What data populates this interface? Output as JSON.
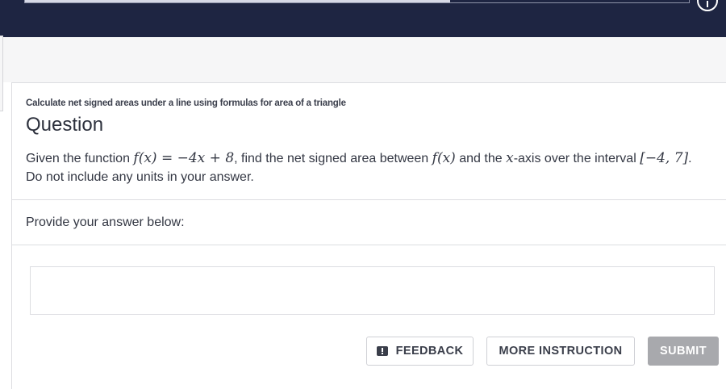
{
  "progress": {
    "fraction": 0.64
  },
  "colors": {
    "topbar": "#1e2542",
    "submit_disabled": "#a8a9ad",
    "page_band": "#f6f6f7"
  },
  "question": {
    "subtitle": "Calculate net signed areas under a line using formulas for area of a triangle",
    "title": "Question",
    "text_before_f": "Given the function ",
    "f_def": "f(x) = −4x + 8",
    "text_middle": ", find the net signed area between ",
    "f_ref": "f(x)",
    "text_and": " and the ",
    "x_var": "x",
    "text_axis": "-axis over the interval ",
    "interval": "[−4, 7]",
    "text_after": ". Do not include any units in your answer."
  },
  "answer": {
    "label": "Provide your answer below:",
    "value": ""
  },
  "buttons": {
    "feedback": "FEEDBACK",
    "more_instruction": "MORE INSTRUCTION",
    "submit": "SUBMIT"
  },
  "icons": {
    "info": "info-icon",
    "feedback": "feedback-icon"
  }
}
